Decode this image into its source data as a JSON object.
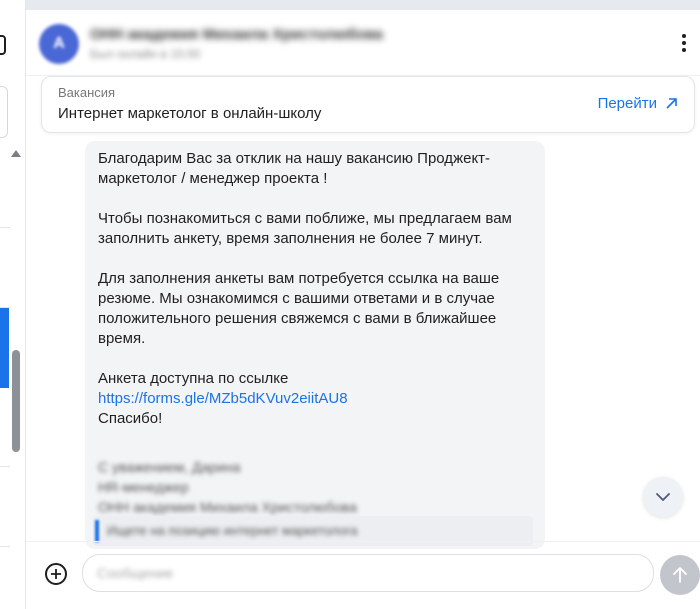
{
  "sidebar": {
    "icon": "app-icon",
    "active_color": "#1a73e8"
  },
  "chat": {
    "name": "ОНН академия Михаила Христолюбова",
    "status": "Был онлайн в 15:00",
    "avatar_glyph": "А"
  },
  "vacancy": {
    "label": "Вакансия",
    "title": "Интернет маркетолог в онлайн-школу",
    "action": "Перейти"
  },
  "message": {
    "paragraphs": [
      "Благодарим Вас за отклик на нашу вакансию Проджект-маркетолог / менеджер проекта !",
      "Чтобы познакомиться с вами поближе, мы предлагаем вам заполнить анкету, время заполнения не более 7 минут.",
      "Для заполнения анкеты вам потребуется ссылка на ваше резюме. Мы ознакомимся с вашими ответами и в случае положительного решения свяжемся с вами в ближайшее время."
    ],
    "link_intro": "Анкета доступна по ссылке",
    "link": "https://forms.gle/MZb5dKVuv2eiitAU8",
    "thanks": "Спасибо!",
    "signature": [
      "С уважением, Дарина",
      "HR-менеджер",
      "ОНН академия Михаила Христолюбова"
    ],
    "quote": "Ищете на позицию интернет маркетолога"
  },
  "composer": {
    "placeholder": "Сообщение"
  },
  "colors": {
    "accent": "#1a73e8",
    "bubble": "#f3f4f6",
    "send_disabled": "#c2c6cc"
  }
}
